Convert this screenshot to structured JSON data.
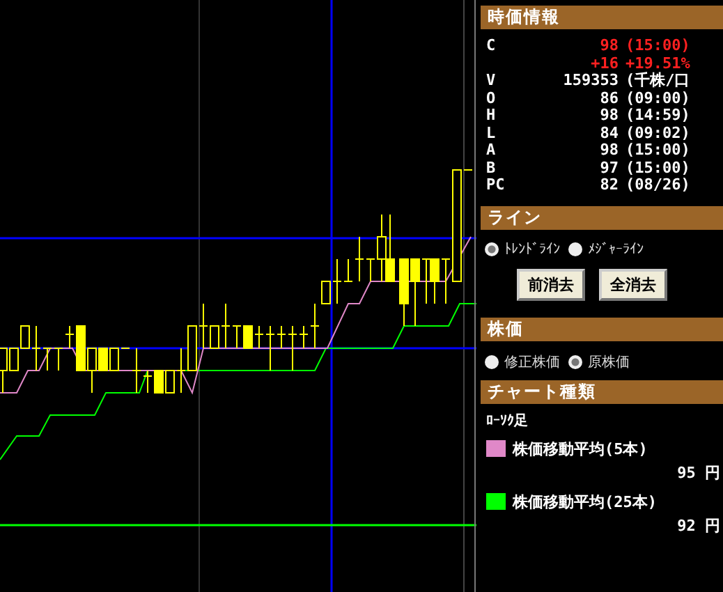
{
  "quote_info": {
    "title": "時価情報",
    "rows": [
      {
        "label": "C",
        "value": "98",
        "detail": "(15:00)",
        "kind": "alert"
      },
      {
        "label": "",
        "value": "+16",
        "detail": "+19.51%",
        "kind": "alert"
      },
      {
        "label": "V",
        "value": "159353",
        "detail": "(千株/口",
        "kind": "normal"
      },
      {
        "label": "O",
        "value": "86",
        "detail": "(09:00)",
        "kind": "normal"
      },
      {
        "label": "H",
        "value": "98",
        "detail": "(14:59)",
        "kind": "normal"
      },
      {
        "label": "L",
        "value": "84",
        "detail": "(09:02)",
        "kind": "normal"
      },
      {
        "label": "A",
        "value": "98",
        "detail": "(15:00)",
        "kind": "normal"
      },
      {
        "label": "B",
        "value": "97",
        "detail": "(15:00)",
        "kind": "normal"
      },
      {
        "label": "PC",
        "value": "82",
        "detail": "(08/26)",
        "kind": "normal"
      }
    ]
  },
  "line": {
    "title": "ライン",
    "options": [
      {
        "label": "ﾄﾚﾝﾄﾞﾗｲﾝ",
        "selected": true
      },
      {
        "label": "ﾒｼﾞｬｰﾗｲﾝ",
        "selected": false
      }
    ],
    "buttons": [
      "前消去",
      "全消去"
    ]
  },
  "price": {
    "title": "株価",
    "options": [
      {
        "label": "修正株価",
        "selected": false
      },
      {
        "label": "原株価",
        "selected": true
      }
    ]
  },
  "chart_type": {
    "title": "チャート種類",
    "name": "ﾛｰｿｸ足",
    "legend": [
      {
        "label": "株価移動平均(5本)",
        "value": "95 円",
        "color": "#e088c8"
      },
      {
        "label": "株価移動平均(25本)",
        "value": "92 円",
        "color": "#00ff00"
      }
    ]
  }
}
